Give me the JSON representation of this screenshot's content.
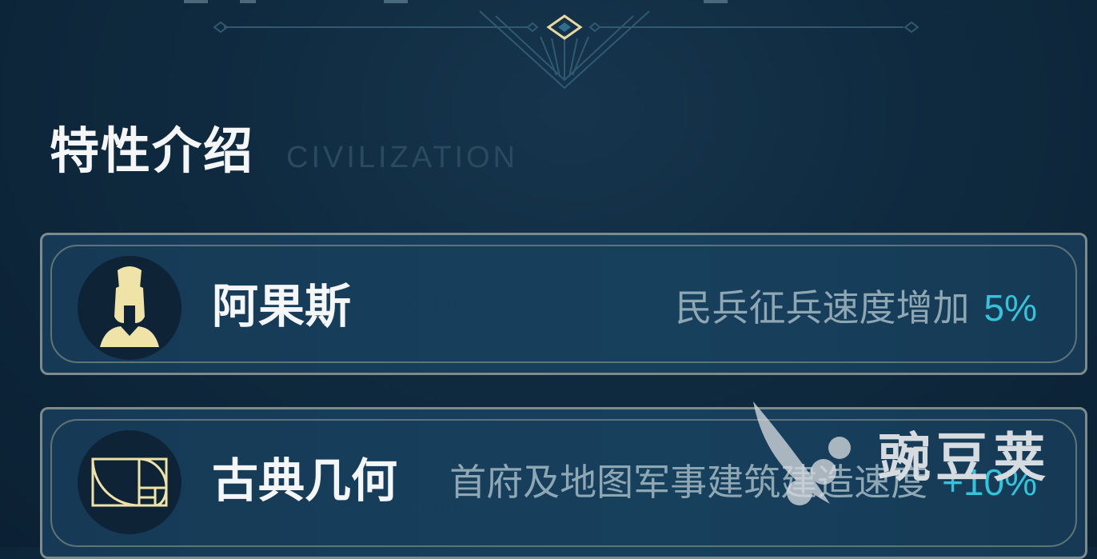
{
  "section": {
    "title": "特性介绍",
    "subtitle": "CIVILIZATION"
  },
  "traits": [
    {
      "name": "阿果斯",
      "description": "民兵征兵速度增加",
      "value": "5%",
      "icon": "spartan-helmet-icon"
    },
    {
      "name": "古典几何",
      "description": "首府及地图军事建筑建造速度",
      "value": "+10%",
      "icon": "golden-spiral-icon"
    }
  ],
  "watermark": {
    "text": "豌豆荚"
  },
  "colors": {
    "background": "#0f2a3f",
    "accent_value": "#34c3db",
    "icon_gold": "#f0e3a8",
    "border": "#7d8c8a"
  }
}
